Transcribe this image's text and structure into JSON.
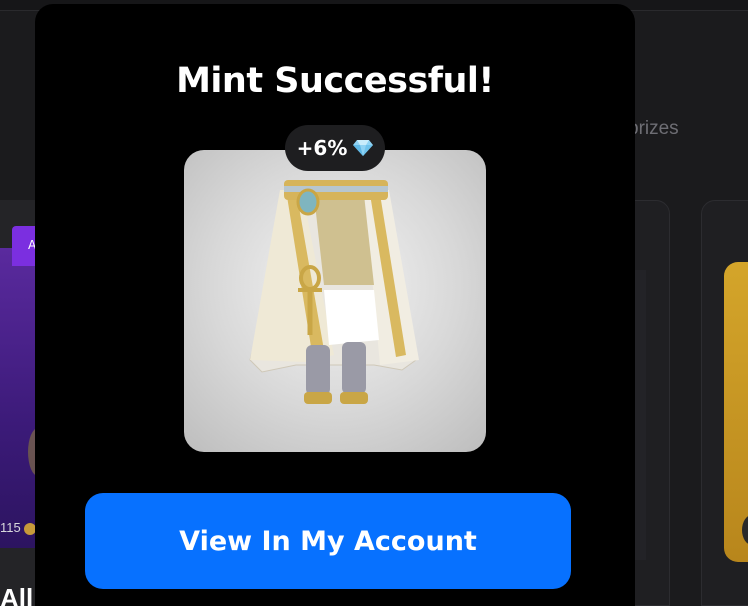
{
  "background": {
    "prizes_text": "prizes",
    "left_card": {
      "badge_text": "A",
      "price": "115",
      "title_fragment": "All"
    }
  },
  "modal": {
    "title": "Mint Successful!",
    "bonus_badge": {
      "text": "+6%",
      "icon": "diamond-icon"
    },
    "item_image": {
      "icon": "robe-item-image"
    },
    "cta_label": "View In My Account"
  },
  "colors": {
    "cta": "#0771ff",
    "modal_bg": "#000000",
    "page_bg": "#1b1b1d"
  }
}
